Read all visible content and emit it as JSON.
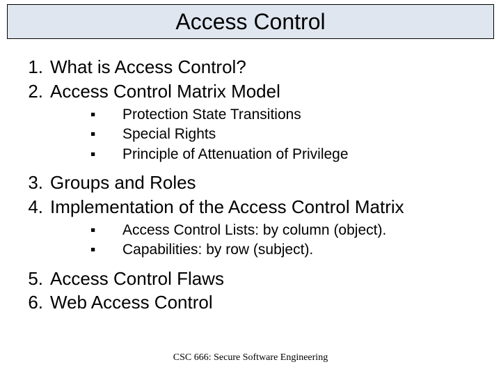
{
  "title": "Access Control",
  "items": [
    {
      "n": "1.",
      "text": "What is Access Control?"
    },
    {
      "n": "2.",
      "text": "Access Control Matrix Model"
    }
  ],
  "sub_a": [
    "Protection State Transitions",
    "Special Rights",
    "Principle of Attenuation of Privilege"
  ],
  "items2": [
    {
      "n": "3.",
      "text": "Groups and Roles"
    },
    {
      "n": "4.",
      "text": "Implementation of the Access Control Matrix"
    }
  ],
  "sub_b": [
    "Access Control Lists: by column (object).",
    "Capabilities: by row (subject)."
  ],
  "items3": [
    {
      "n": "5.",
      "text": "Access Control Flaws"
    },
    {
      "n": "6.",
      "text": "Web Access Control"
    }
  ],
  "bullet_glyph": "▪",
  "footer": "CSC 666: Secure Software Engineering"
}
